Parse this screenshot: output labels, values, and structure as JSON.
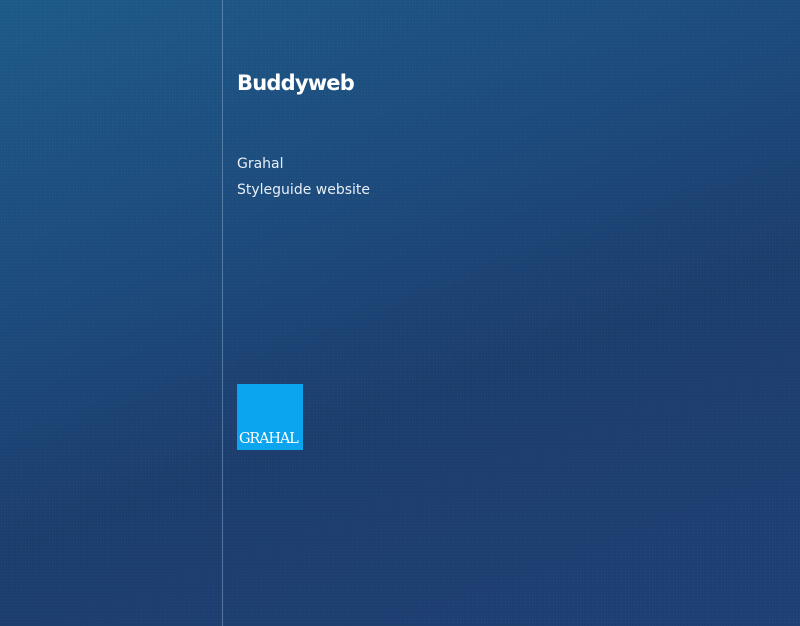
{
  "brand": {
    "logo_text": "Buddyweb"
  },
  "project": {
    "client": "Grahal",
    "title": "Styleguide website"
  },
  "client_logo": {
    "text": "GRAHAL",
    "color": "#0aa4ef"
  },
  "colors": {
    "background": "#1c4a7c",
    "divider": "#8fb4d8",
    "text": "#ffffff"
  }
}
